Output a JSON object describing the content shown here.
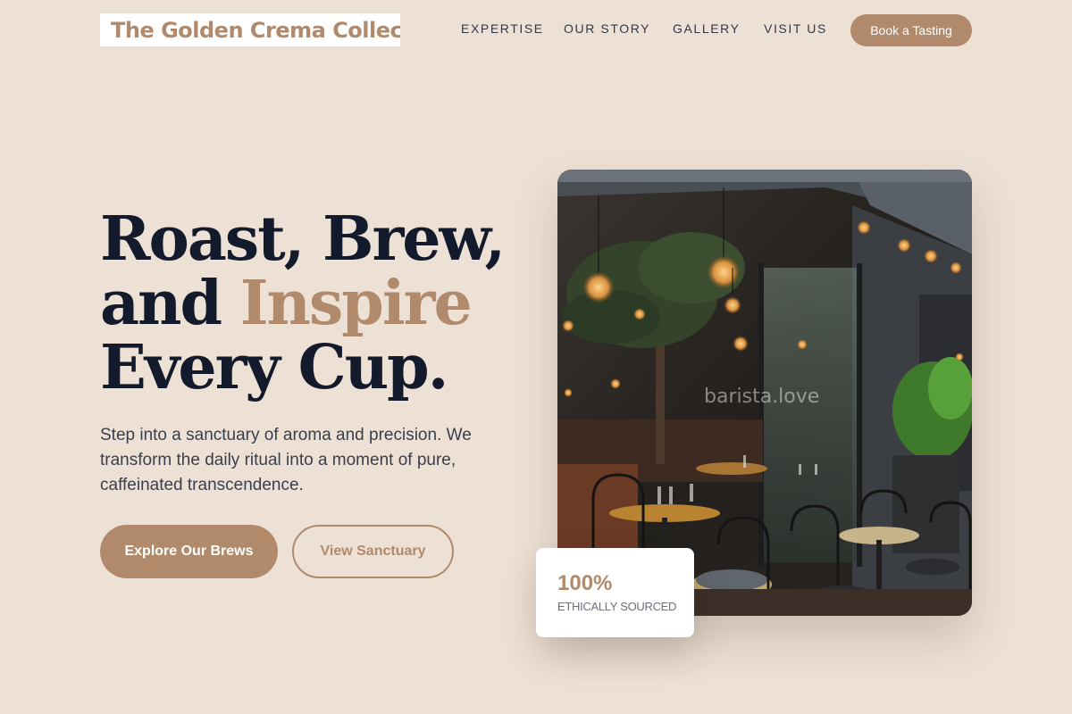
{
  "brand": {
    "name": "The Golden Crema Collective"
  },
  "nav": {
    "items": [
      {
        "label": "EXPERTISE"
      },
      {
        "label": "OUR STORY"
      },
      {
        "label": "GALLERY"
      },
      {
        "label": "VISIT US"
      }
    ],
    "cta_label": "Book a Tasting"
  },
  "hero": {
    "headline_line1": "Roast, Brew,",
    "headline_line2_start": "and ",
    "headline_accent": "Inspire",
    "headline_line3": "Every Cup.",
    "subtext": "Step into a sanctuary of aroma and precision. We transform the daily ritual into a moment of pure, caffeinated transcendence.",
    "primary_button": "Explore Our Brews",
    "secondary_button": "View Sanctuary"
  },
  "image": {
    "watermark": "barista.love"
  },
  "stat": {
    "value": "100%",
    "label": "ETHICALLY SOURCED"
  },
  "colors": {
    "accent": "#b08a6a",
    "background": "#ede0d5",
    "heading": "#131a2b"
  }
}
